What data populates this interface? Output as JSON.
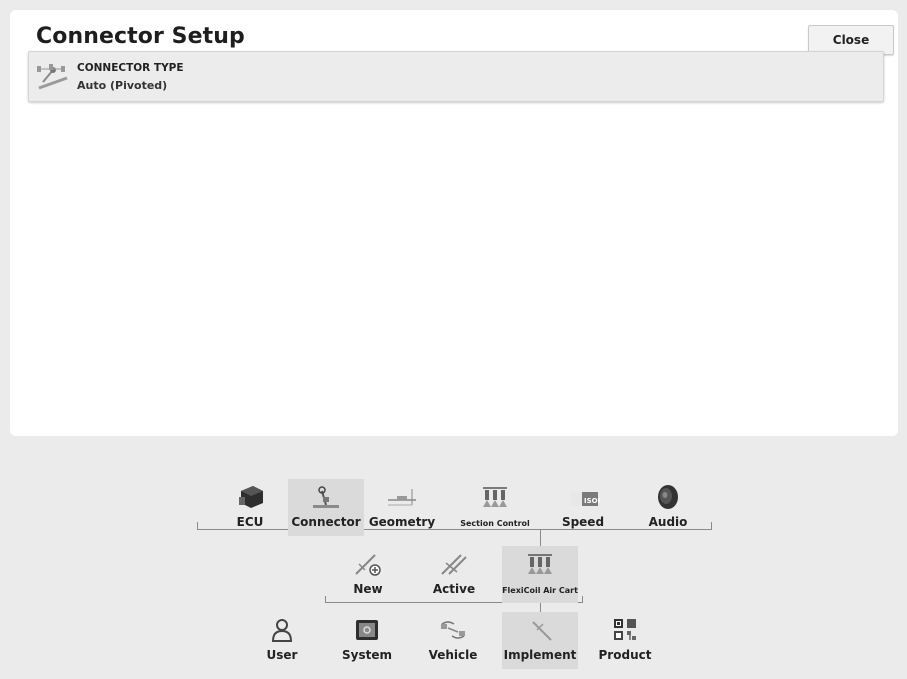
{
  "header": {
    "title": "Connector Setup",
    "close_label": "Close"
  },
  "setting": {
    "label": "CONNECTOR TYPE",
    "value": "Auto (Pivoted)"
  },
  "nav": {
    "top_row": [
      {
        "label": "ECU",
        "icon": "ecu-icon",
        "selected": false
      },
      {
        "label": "Connector",
        "icon": "connector-icon",
        "selected": true
      },
      {
        "label": "Geometry",
        "icon": "geometry-icon",
        "selected": false
      },
      {
        "label": "Section Control",
        "icon": "section-control-icon",
        "selected": false
      },
      {
        "label": "Speed",
        "icon": "isobus-speed-icon",
        "selected": false
      },
      {
        "label": "Audio",
        "icon": "speaker-icon",
        "selected": false
      }
    ],
    "middle_row": [
      {
        "label": "New",
        "icon": "new-implement-icon",
        "selected": false
      },
      {
        "label": "Active",
        "icon": "active-implement-icon",
        "selected": false
      },
      {
        "label": "FlexiCoil Air Cart",
        "icon": "air-cart-icon",
        "selected": true
      }
    ],
    "bottom_row": [
      {
        "label": "User",
        "icon": "user-icon",
        "selected": false
      },
      {
        "label": "System",
        "icon": "system-icon",
        "selected": false
      },
      {
        "label": "Vehicle",
        "icon": "vehicle-icon",
        "selected": false
      },
      {
        "label": "Implement",
        "icon": "implement-icon",
        "selected": true
      },
      {
        "label": "Product",
        "icon": "product-icon",
        "selected": false
      }
    ],
    "isobus_text": "ISOBUS"
  }
}
